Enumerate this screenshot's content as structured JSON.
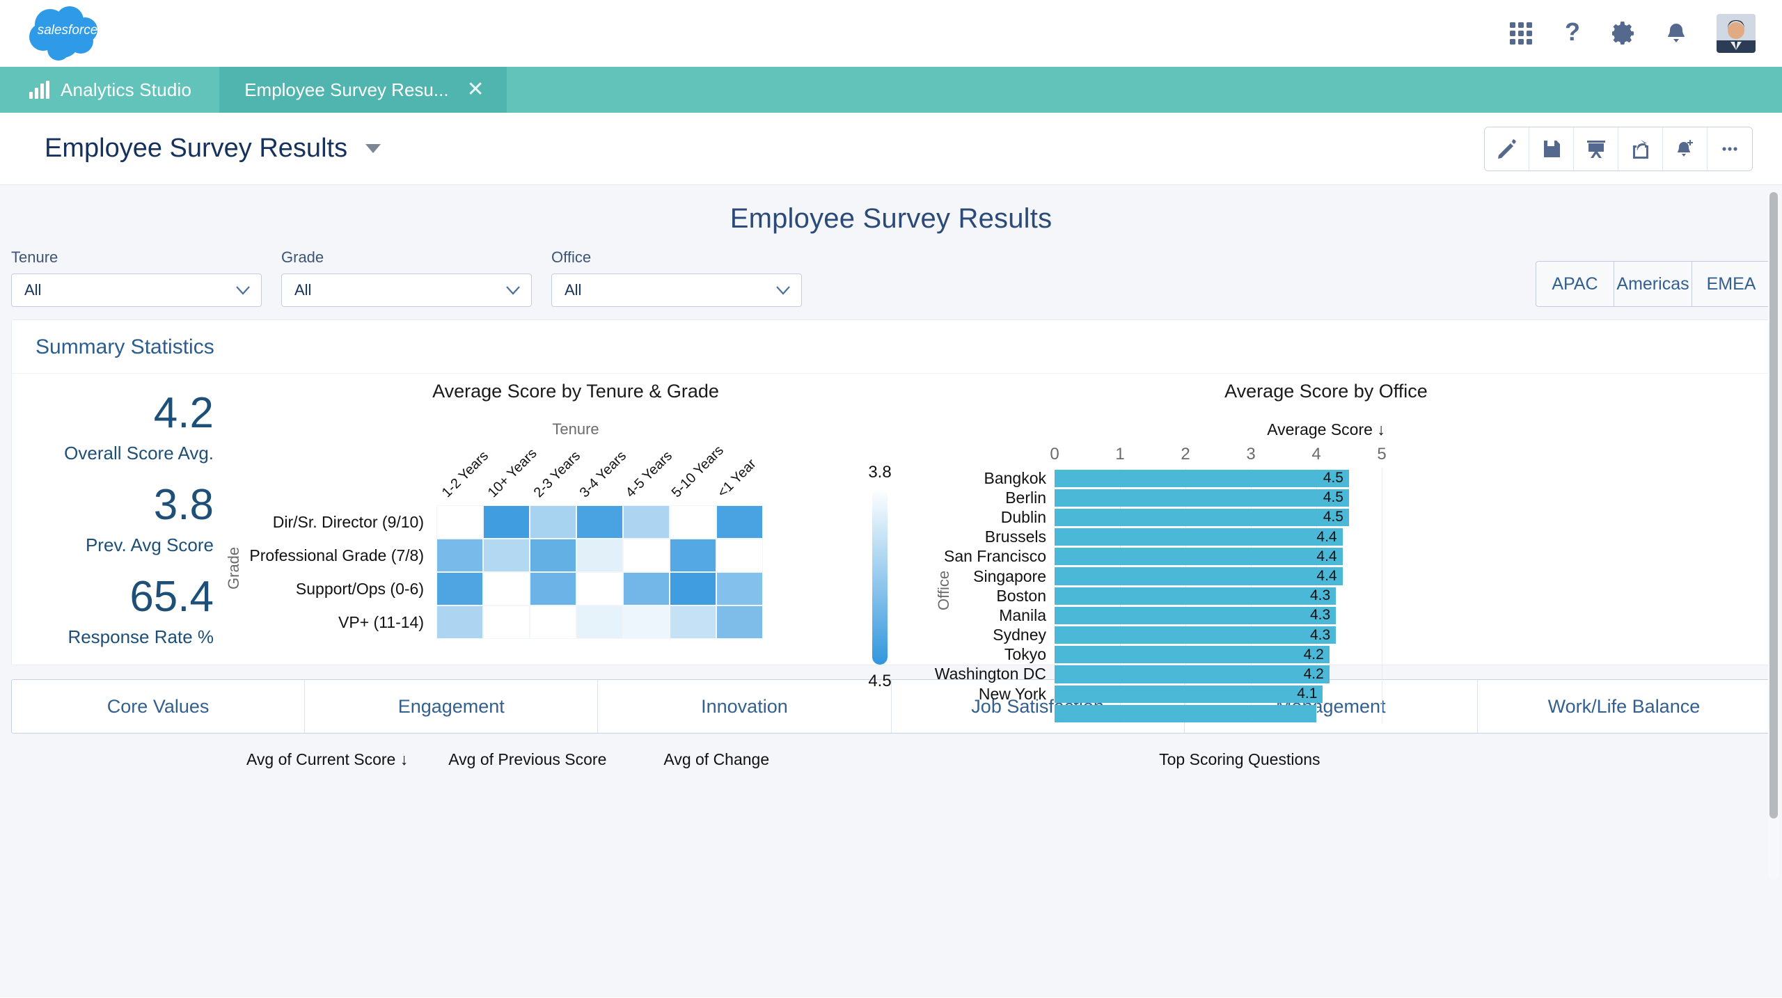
{
  "header": {
    "logo_alt": "salesforce",
    "icons": [
      "app-launcher-icon",
      "help-icon",
      "gear-icon",
      "notifications-icon",
      "avatar"
    ]
  },
  "tabbar": {
    "app_tab": "Analytics Studio",
    "doc_tab": "Employee Survey Resu...",
    "close_label": "✕"
  },
  "toolbar": {
    "title": "Employee Survey Results",
    "buttons": [
      "edit-button",
      "save-button",
      "present-button",
      "share-button",
      "subscribe-button",
      "more-button"
    ]
  },
  "dashboard": {
    "title": "Employee Survey Results"
  },
  "filters": [
    {
      "label": "Tenure",
      "value": "All"
    },
    {
      "label": "Grade",
      "value": "All"
    },
    {
      "label": "Office",
      "value": "All"
    }
  ],
  "regions": [
    "APAC",
    "Americas",
    "EMEA"
  ],
  "summary": {
    "heading": "Summary Statistics",
    "kpis": [
      {
        "value": "4.2",
        "label": "Overall Score Avg."
      },
      {
        "value": "3.8",
        "label": "Prev. Avg Score"
      },
      {
        "value": "65.4",
        "label": "Response Rate %"
      }
    ]
  },
  "bottom_tabs": [
    "Core Values",
    "Engagement",
    "Innovation",
    "Job Satisfaction",
    "Management",
    "Work/Life Balance"
  ],
  "bottom_subheads": {
    "a": "Avg of Current Score ↓",
    "b": "Avg of Previous Score",
    "c": "Avg of Change",
    "d": "Top Scoring Questions"
  },
  "colors": {
    "brand_teal": "#62c3bb",
    "brand_teal_active": "#4fb5ae",
    "navy": "#16325c",
    "bar_blue": "#4bb8d8",
    "heat_max": "#3196dd",
    "heat_min": "#ffffff"
  },
  "chart_data": [
    {
      "type": "heatmap",
      "title": "Average Score by Tenure & Grade",
      "xlabel": "Tenure",
      "ylabel": "Grade",
      "x_categories": [
        "1-2 Years",
        "10+ Years",
        "2-3 Years",
        "3-4 Years",
        "4-5 Years",
        "5-10 Years",
        "<1 Year"
      ],
      "y_categories": [
        "Dir/Sr. Director (9/10)",
        "Professional Grade (7/8)",
        "Support/Ops (0-6)",
        "VP+ (11-14)"
      ],
      "legend": {
        "min_label": "3.8",
        "max_label": "4.5",
        "min_color": "#ffffff",
        "max_color": "#3196dd",
        "position": "right"
      },
      "values": [
        [
          3.8,
          4.45,
          4.1,
          4.42,
          4.08,
          3.8,
          4.42
        ],
        [
          4.26,
          4.06,
          4.33,
          3.9,
          3.8,
          4.38,
          3.8
        ],
        [
          4.4,
          3.8,
          4.3,
          3.8,
          4.28,
          4.45,
          4.22
        ],
        [
          4.08,
          3.8,
          3.8,
          3.88,
          3.86,
          4.0,
          4.24
        ]
      ]
    },
    {
      "type": "bar",
      "orientation": "horizontal",
      "title": "Average Score by Office",
      "xlabel": "Average Score ↓",
      "ylabel": "Office",
      "xlim": [
        0,
        5
      ],
      "xticks": [
        "0",
        "1",
        "2",
        "3",
        "4",
        "5"
      ],
      "categories": [
        "Bangkok",
        "Berlin",
        "Dublin",
        "Brussels",
        "San Francisco",
        "Singapore",
        "Boston",
        "Manila",
        "Sydney",
        "Tokyo",
        "Washington DC",
        "New York",
        ""
      ],
      "values": [
        4.5,
        4.5,
        4.5,
        4.4,
        4.4,
        4.4,
        4.3,
        4.3,
        4.3,
        4.2,
        4.2,
        4.1,
        4.0
      ],
      "value_labels": [
        "4.5",
        "4.5",
        "4.5",
        "4.4",
        "4.4",
        "4.4",
        "4.3",
        "4.3",
        "4.3",
        "4.2",
        "4.2",
        "4.1",
        ""
      ],
      "bar_color": "#4bb8d8"
    }
  ]
}
